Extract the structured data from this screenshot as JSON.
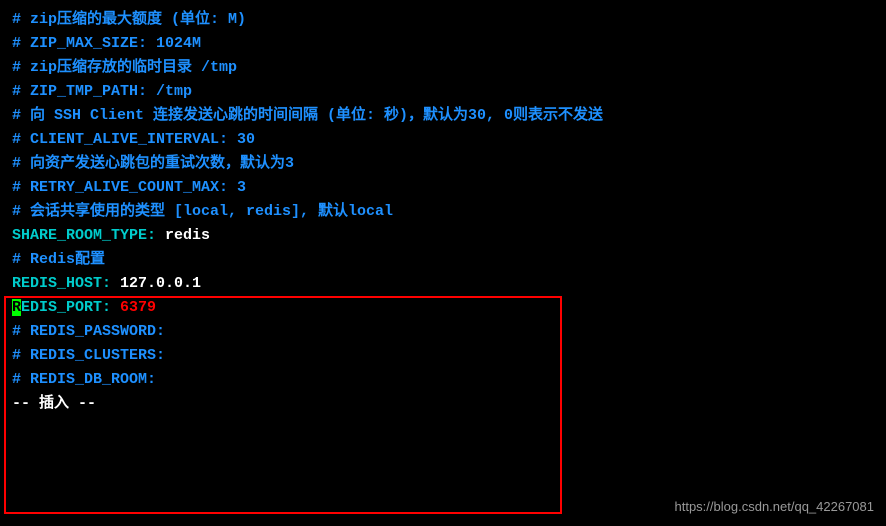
{
  "lines": {
    "l1": "# zip压缩的最大额度 (单位: M)",
    "l2": "# ZIP_MAX_SIZE: 1024M",
    "l3": "",
    "l4": "# zip压缩存放的临时目录 /tmp",
    "l5": "# ZIP_TMP_PATH: /tmp",
    "l6": "",
    "l7": "# 向 SSH Client 连接发送心跳的时间间隔 (单位: 秒)，默认为30, 0则表示不发送",
    "l8": "# CLIENT_ALIVE_INTERVAL: 30",
    "l9": "",
    "l10": "# 向资产发送心跳包的重试次数，默认为3",
    "l11": "# RETRY_ALIVE_COUNT_MAX: 3",
    "l12": "",
    "l13": "# 会话共享使用的类型 [local, redis], 默认local",
    "l14_key": "SHARE_ROOM_TYPE: ",
    "l14_val": "redis",
    "l15": "",
    "l16": "# Redis配置",
    "l17_key": "REDIS_HOST: ",
    "l17_val": "127.0.0.1",
    "l18_cursor": "R",
    "l18_key": "EDIS_PORT: ",
    "l18_val": "6379",
    "l19": "# REDIS_PASSWORD:",
    "l20": "# REDIS_CLUSTERS:",
    "l21": "# REDIS_DB_ROOM:",
    "mode": "-- 插入 --"
  },
  "watermark": "https://blog.csdn.net/qq_42267081"
}
